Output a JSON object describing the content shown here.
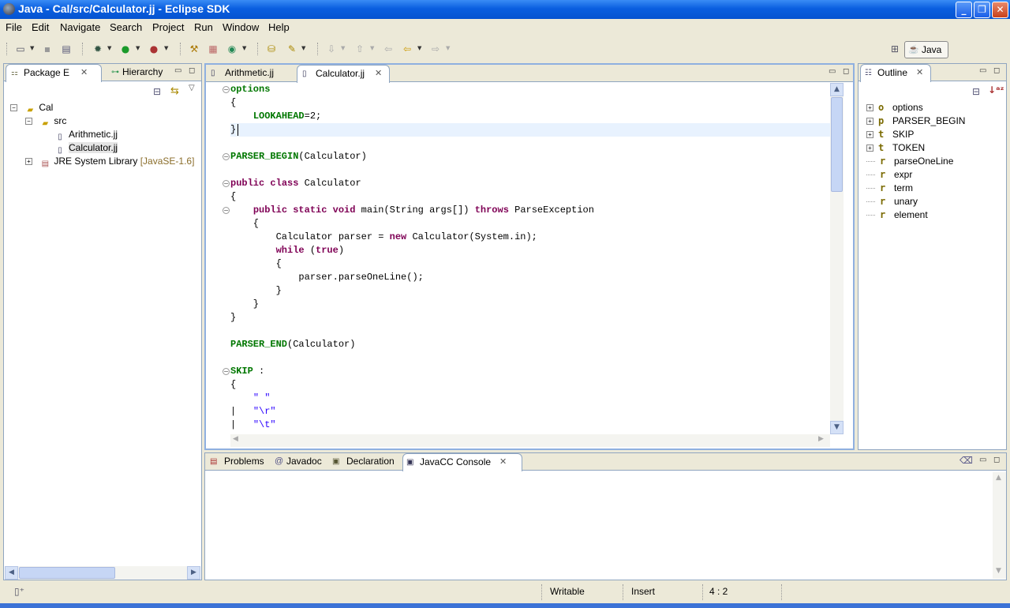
{
  "window": {
    "title": "Java - Cal/src/Calculator.jj - Eclipse SDK"
  },
  "menu": [
    "File",
    "Edit",
    "Navigate",
    "Search",
    "Project",
    "Run",
    "Window",
    "Help"
  ],
  "perspective": {
    "label": "Java"
  },
  "package_explorer": {
    "tabs": [
      {
        "label": "Package E"
      },
      {
        "label": "Hierarchy"
      }
    ],
    "tree": [
      {
        "label": "Cal"
      },
      {
        "label": "src"
      },
      {
        "label": "Arithmetic.jj"
      },
      {
        "label": "Calculator.jj"
      },
      {
        "label": "JRE System Library",
        "suffix": "[JavaSE-1.6]"
      }
    ]
  },
  "editor": {
    "tabs": [
      {
        "label": "Arithmetic.jj"
      },
      {
        "label": "Calculator.jj"
      }
    ],
    "lines": [
      [
        [
          "jk",
          "options"
        ]
      ],
      [
        [
          "p",
          "{"
        ]
      ],
      [
        [
          "p",
          "    "
        ],
        [
          "jk",
          "LOOKAHEAD"
        ],
        [
          "p",
          "=2;"
        ]
      ],
      [
        [
          "p",
          "}"
        ]
      ],
      [
        [
          "p",
          ""
        ]
      ],
      [
        [
          "jk",
          "PARSER_BEGIN"
        ],
        [
          "p",
          "(Calculator)"
        ]
      ],
      [
        [
          "p",
          ""
        ]
      ],
      [
        [
          "kw",
          "public"
        ],
        [
          "p",
          " "
        ],
        [
          "kw",
          "class"
        ],
        [
          "p",
          " Calculator"
        ]
      ],
      [
        [
          "p",
          "{"
        ]
      ],
      [
        [
          "p",
          "    "
        ],
        [
          "kw",
          "public"
        ],
        [
          "p",
          " "
        ],
        [
          "kw",
          "static"
        ],
        [
          "p",
          " "
        ],
        [
          "kw",
          "void"
        ],
        [
          "p",
          " main(String args[]) "
        ],
        [
          "kw",
          "throws"
        ],
        [
          "p",
          " ParseException"
        ]
      ],
      [
        [
          "p",
          "    {"
        ]
      ],
      [
        [
          "p",
          "        Calculator parser = "
        ],
        [
          "kw",
          "new"
        ],
        [
          "p",
          " Calculator(System.in);"
        ]
      ],
      [
        [
          "p",
          "        "
        ],
        [
          "kw",
          "while"
        ],
        [
          "p",
          " ("
        ],
        [
          "kw",
          "true"
        ],
        [
          "p",
          ")"
        ]
      ],
      [
        [
          "p",
          "        {"
        ]
      ],
      [
        [
          "p",
          "            parser.parseOneLine();"
        ]
      ],
      [
        [
          "p",
          "        }"
        ]
      ],
      [
        [
          "p",
          "    }"
        ]
      ],
      [
        [
          "p",
          "}"
        ]
      ],
      [
        [
          "p",
          ""
        ]
      ],
      [
        [
          "jk",
          "PARSER_END"
        ],
        [
          "p",
          "(Calculator)"
        ]
      ],
      [
        [
          "p",
          ""
        ]
      ],
      [
        [
          "jk",
          "SKIP"
        ],
        [
          "p",
          " :"
        ]
      ],
      [
        [
          "p",
          "{"
        ]
      ],
      [
        [
          "p",
          "    "
        ],
        [
          "str",
          "\" \""
        ]
      ],
      [
        [
          "p",
          "|   "
        ],
        [
          "str",
          "\"\\r\""
        ]
      ],
      [
        [
          "p",
          "|   "
        ],
        [
          "str",
          "\"\\t\""
        ]
      ]
    ]
  },
  "outline": {
    "tab": {
      "label": "Outline"
    },
    "items": [
      {
        "icon": "o",
        "label": "options",
        "expandable": true
      },
      {
        "icon": "p",
        "label": "PARSER_BEGIN",
        "expandable": true
      },
      {
        "icon": "t",
        "label": "SKIP",
        "expandable": true
      },
      {
        "icon": "t",
        "label": "TOKEN",
        "expandable": true
      },
      {
        "icon": "r",
        "label": "parseOneLine",
        "expandable": false
      },
      {
        "icon": "r",
        "label": "expr",
        "expandable": false
      },
      {
        "icon": "r",
        "label": "term",
        "expandable": false
      },
      {
        "icon": "r",
        "label": "unary",
        "expandable": false
      },
      {
        "icon": "r",
        "label": "element",
        "expandable": false
      }
    ]
  },
  "bottom_panel": {
    "tabs": [
      {
        "label": "Problems"
      },
      {
        "label": "Javadoc"
      },
      {
        "label": "Declaration"
      },
      {
        "label": "JavaCC Console"
      }
    ]
  },
  "status": {
    "writable": "Writable",
    "mode": "Insert",
    "position": "4 : 2"
  },
  "icons": {
    "at": "@"
  }
}
